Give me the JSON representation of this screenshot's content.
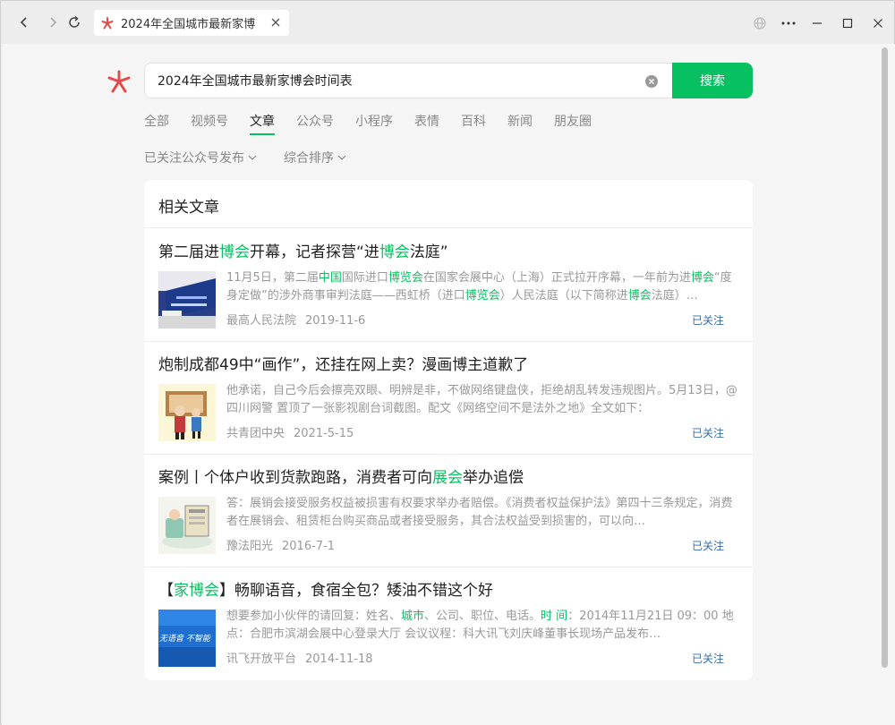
{
  "browser": {
    "tab_title": "2024年全国城市最新家博会时间表"
  },
  "search": {
    "query": "2024年全国城市最新家博会时间表",
    "button_label": "搜索"
  },
  "type_tabs": [
    "全部",
    "视频号",
    "文章",
    "公众号",
    "小程序",
    "表情",
    "百科",
    "新闻",
    "朋友圈"
  ],
  "active_tab": "文章",
  "filters": {
    "account_filter": "已关注公众号发布",
    "sort_filter": "综合排序"
  },
  "section_title": "相关文章",
  "articles": [
    {
      "title_parts": [
        {
          "text": "第二届进",
          "hl": false
        },
        {
          "text": "博会",
          "hl": true
        },
        {
          "text": "开幕，记者探营“进",
          "hl": false
        },
        {
          "text": "博会",
          "hl": true
        },
        {
          "text": "法庭”",
          "hl": false
        }
      ],
      "summary_parts": [
        {
          "text": "11月5日，第二届",
          "hl": false
        },
        {
          "text": "中国",
          "hl": true
        },
        {
          "text": "国际进口",
          "hl": false
        },
        {
          "text": "博览会",
          "hl": true
        },
        {
          "text": "在国家会展中心（上海）正式拉开序幕，一年前为进",
          "hl": false
        },
        {
          "text": "博会",
          "hl": true
        },
        {
          "text": "“度身定做”的涉外商事审判法庭——西虹桥（进口",
          "hl": false
        },
        {
          "text": "博览会",
          "hl": true
        },
        {
          "text": "）人民法庭（以下简称进",
          "hl": false
        },
        {
          "text": "博会",
          "hl": true
        },
        {
          "text": "法庭）…",
          "hl": false
        }
      ],
      "source": "最高人民法院",
      "date": "2019-11-6",
      "status": "已关注"
    },
    {
      "title_parts": [
        {
          "text": "炮制成都49中“画作”，还挂在网上卖？漫画博主道歉了",
          "hl": false
        }
      ],
      "summary_parts": [
        {
          "text": "他承诺，自己今后会擦亮双眼、明辨是非，不做网络键盘侠，拒绝胡乱转发违规图片。5月13日，@四川网警 置顶了一张影视剧台词截图。配文《网络空间不是法外之地》全文如下：",
          "hl": false
        }
      ],
      "source": "共青团中央",
      "date": "2021-5-15",
      "status": "已关注"
    },
    {
      "title_parts": [
        {
          "text": "案例丨个体户收到货款跑路，消费者可向",
          "hl": false
        },
        {
          "text": "展会",
          "hl": true
        },
        {
          "text": "举办追偿",
          "hl": false
        }
      ],
      "summary_parts": [
        {
          "text": "答：展销会接受服务权益被损害有权要求举办者赔偿。《消费者权益保护法》第四十三条规定，消费者在展销会、租赁柜台购买商品或者接受服务，其合法权益受到损害的，可以向…",
          "hl": false
        }
      ],
      "source": "豫法阳光",
      "date": "2016-7-1",
      "status": "已关注"
    },
    {
      "title_parts": [
        {
          "text": "【",
          "hl": false
        },
        {
          "text": "家博会",
          "hl": true
        },
        {
          "text": "】畅聊语音，食宿全包？矮油不错这个好",
          "hl": false
        }
      ],
      "summary_parts": [
        {
          "text": "想要参加小伙伴的请回复：姓名、",
          "hl": false
        },
        {
          "text": "城市",
          "hl": true
        },
        {
          "text": "、公司、职位、电话。",
          "hl": false
        },
        {
          "text": "时 间",
          "hl": true
        },
        {
          "text": "：2014年11月21日 09：00 地 点：合肥市滨湖会展中心登录大厅 会议议程：科大讯飞刘庆峰董事长现场产品发布…",
          "hl": false
        }
      ],
      "source": "讯飞开放平台",
      "date": "2014-11-18",
      "status": "已关注",
      "thumb_text": "无语音 不智能"
    }
  ]
}
